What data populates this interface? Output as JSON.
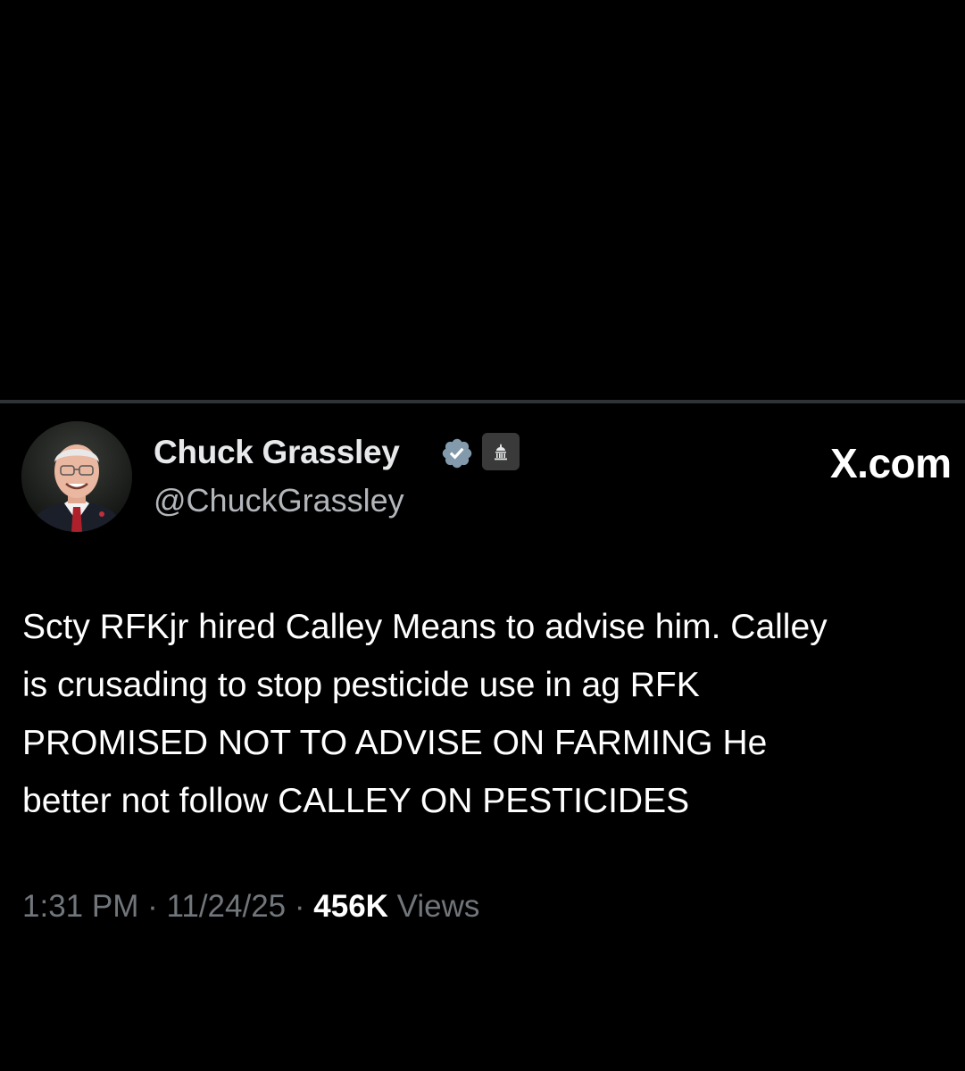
{
  "tweet": {
    "author": {
      "display_name": "Chuck Grassley",
      "handle": "@ChuckGrassley",
      "verified_icon": "verified-badge-icon",
      "affiliation_icon": "capitol-building-icon"
    },
    "brand": "X.com",
    "text_lines": [
      "Scty RFKjr hired Calley Means to advise him. Calley",
      "is crusading to stop pesticide use in ag RFK",
      "PROMISED NOT TO ADVISE ON FARMING He",
      "better not follow CALLEY ON PESTICIDES"
    ],
    "time": "1:31 PM",
    "date": "11/24/25",
    "separator": "·",
    "views_count": "456K",
    "views_label": "Views"
  },
  "colors": {
    "background": "#000000",
    "divider": "#2f3336",
    "text_primary": "#e7e9ea",
    "text_secondary": "#71767b",
    "verified_badge": "#829aab"
  }
}
